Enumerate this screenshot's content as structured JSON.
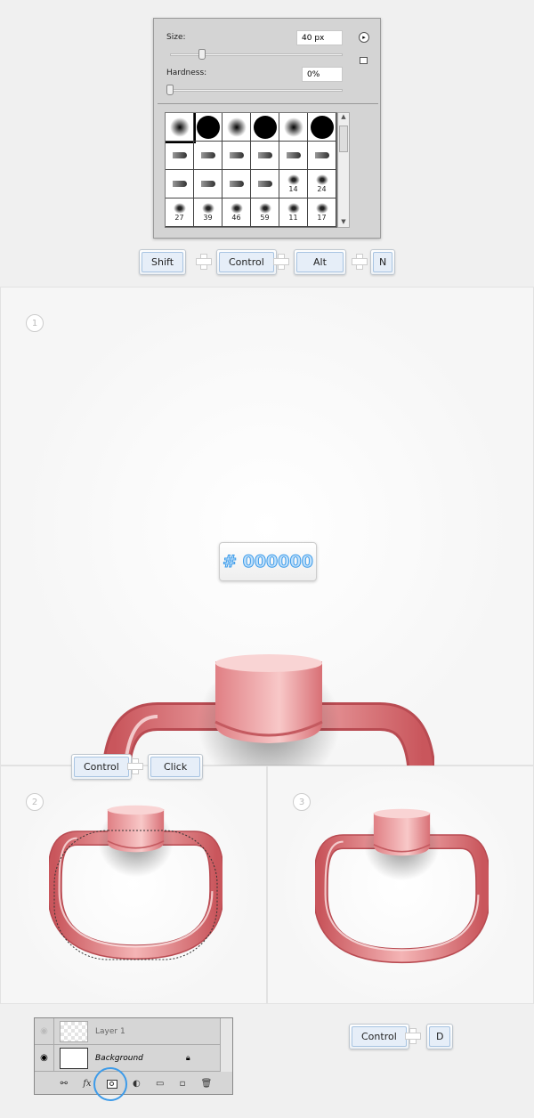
{
  "brush_panel": {
    "size_label": "Size:",
    "size_value": "40 px",
    "size_fraction": 0.25,
    "hardness_label": "Hardness:",
    "hardness_value": "0%",
    "hardness_fraction": 0,
    "presets": [
      "",
      "",
      "",
      "",
      "",
      "",
      "",
      "",
      "",
      "",
      "",
      "",
      "",
      "",
      "",
      "",
      "14",
      "24",
      "27",
      "39",
      "46",
      "59",
      "11",
      "17"
    ]
  },
  "shortcut_1": {
    "keys": [
      "Shift",
      "Control",
      "Alt",
      "N"
    ]
  },
  "step1": {
    "number": "1",
    "color_tag": "# 000000"
  },
  "shortcut_2": {
    "keys": [
      "Control",
      "Click"
    ]
  },
  "step2": {
    "number": "2"
  },
  "step3": {
    "number": "3"
  },
  "layers_panel": {
    "layers": [
      {
        "name": "Layer 1",
        "visible": false
      },
      {
        "name": "Background",
        "visible": true,
        "locked": true
      }
    ],
    "footer_icons": [
      "link-icon",
      "fx-icon",
      "layer-mask-icon",
      "adjustment-icon",
      "folder-icon",
      "new-layer-icon",
      "trash-icon"
    ]
  },
  "shortcut_3": {
    "keys": [
      "Control",
      "D"
    ]
  },
  "colors": {
    "pink": "#e8878a",
    "key_blue": "#e6eef8",
    "tag_text": "#3d9be9"
  }
}
